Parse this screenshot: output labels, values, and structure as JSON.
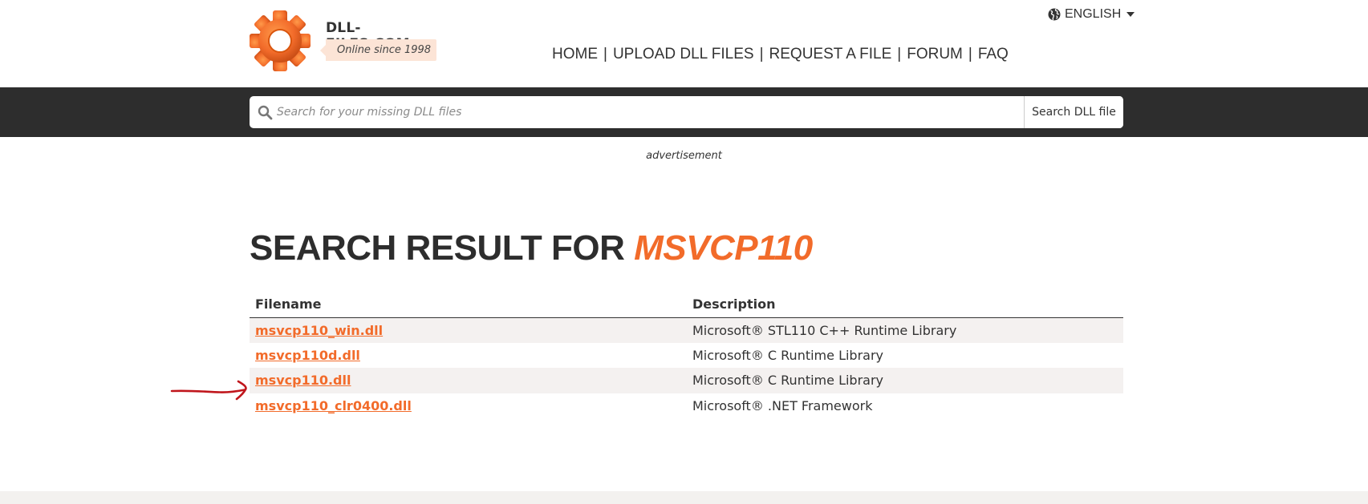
{
  "header": {
    "site_name": "DLL-FILES.COM",
    "tagline": "Online since 1998",
    "language": "ENGLISH",
    "logo_icon": "gear-icon",
    "brand_color": "#f26b2a",
    "nav": [
      {
        "label": "HOME"
      },
      {
        "label": "UPLOAD DLL FILES"
      },
      {
        "label": "REQUEST A FILE"
      },
      {
        "label": "FORUM"
      },
      {
        "label": "FAQ"
      }
    ]
  },
  "search": {
    "placeholder": "Search for your missing DLL files",
    "value": "",
    "button_label": "Search DLL file"
  },
  "main": {
    "ad_label": "advertisement",
    "title_prefix": "SEARCH RESULT FOR ",
    "query": "MSVCP110",
    "table": {
      "headers": [
        "Filename",
        "Description"
      ],
      "rows": [
        {
          "filename": "msvcp110_win.dll",
          "description": "Microsoft® STL110 C++ Runtime Library"
        },
        {
          "filename": "msvcp110d.dll",
          "description": "Microsoft® C Runtime Library"
        },
        {
          "filename": "msvcp110.dll",
          "description": "Microsoft® C Runtime Library"
        },
        {
          "filename": "msvcp110_clr0400.dll",
          "description": "Microsoft® .NET Framework"
        }
      ]
    }
  },
  "colors": {
    "dark_band": "#2d2d2d",
    "accent": "#f26b2a",
    "row_stripe": "#f4f1f0",
    "annotation": "#c0161c"
  }
}
